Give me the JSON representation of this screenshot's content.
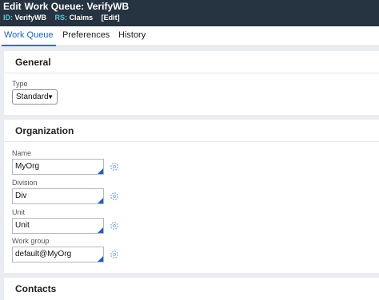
{
  "header": {
    "edit_label": "Edit",
    "title": "Work Queue: VerifyWB",
    "id_key": "ID:",
    "id_value": "VerifyWB",
    "rs_key": "RS:",
    "rs_value": "Claims",
    "edit_link": "[Edit]"
  },
  "tabs": [
    {
      "label": "Work Queue",
      "active": true
    },
    {
      "label": "Preferences",
      "active": false
    },
    {
      "label": "History",
      "active": false
    }
  ],
  "general": {
    "heading": "General",
    "type_label": "Type",
    "type_value": "Standard"
  },
  "organization": {
    "heading": "Organization",
    "name_label": "Name",
    "name_value": "MyOrg",
    "division_label": "Division",
    "division_value": "Div",
    "unit_label": "Unit",
    "unit_value": "Unit",
    "workgroup_label": "Work group",
    "workgroup_value": "default@MyOrg"
  },
  "contacts": {
    "heading": "Contacts"
  },
  "colors": {
    "header_bg": "#263340",
    "accent_teal": "#4ad0d4",
    "tab_active": "#1e63c5",
    "field_corner": "#1d5fc9"
  },
  "icons": [
    "chevron-down-icon",
    "settings-icon"
  ]
}
